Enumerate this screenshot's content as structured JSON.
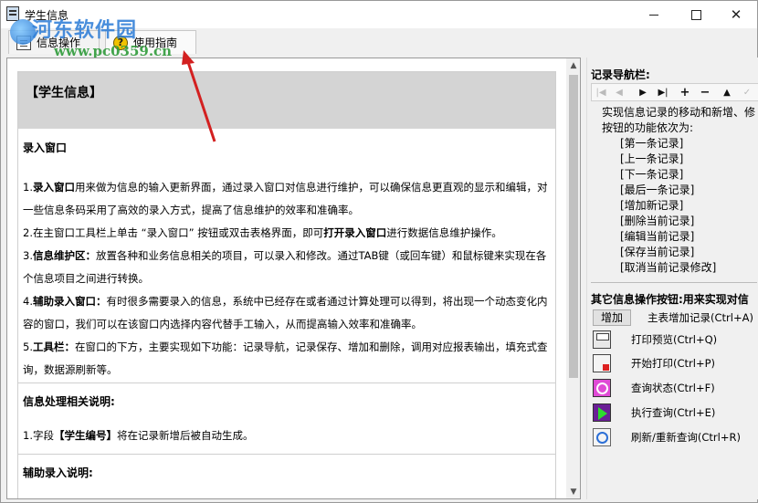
{
  "window": {
    "title": "学生信息",
    "watermark": "河东软件园",
    "watermark_url": "www.pc0359.cn"
  },
  "toolbar": {
    "info_ops_label": "信息操作",
    "guide_label": "使用指南"
  },
  "doc": {
    "header": "【学生信息】",
    "sections": [
      {
        "title": "录入窗口",
        "paras": [
          [
            "1.",
            "录入窗口",
            "用来做为信息的输入更新界面，通过录入窗口对信息进行维护，可以确保信息更直观的显示和编辑，对一些信息条码采用了高效的录入方式，提高了信息维护的效率和准确率。"
          ],
          [
            "2.在主窗口工具栏上单击 “录入窗口” 按钮或双击表格界面，即可",
            "打开录入窗口",
            "进行数据信息维护操作。"
          ],
          [
            "3.",
            "信息维护区：",
            "放置各种和业务信息相关的项目，可以录入和修改。通过TAB键（或回车键）和鼠标键来实现在各个信息项目之间进行转换。"
          ],
          [
            "4.",
            "辅助录入窗口：",
            "有时很多需要录入的信息，系统中已经存在或者通过计算处理可以得到，将出现一个动态变化内容的窗口，我们可以在该窗口内选择内容代替手工输入，从而提高输入效率和准确率。"
          ],
          [
            "5.",
            "工具栏：",
            "在窗口的下方，主要实现如下功能：记录导航，记录保存、增加和删除，调用对应报表输出，填充式查询，数据源刷新等。"
          ]
        ]
      },
      {
        "title": "信息处理相关说明:",
        "paras": [
          [
            "1.字段",
            "【学生编号】",
            "将在记录新增后被自动生成。"
          ]
        ]
      },
      {
        "title": "辅助录入说明:",
        "paras": []
      }
    ]
  },
  "side": {
    "nav_title": "记录导航栏:",
    "nav_desc_1": "实现信息记录的移动和新增、修",
    "nav_desc_2": "按钮的功能依次为:",
    "nav_items": [
      "[第一条记录]",
      "[上一条记录]",
      "[下一条记录]",
      "[最后一条记录]",
      "[增加新记录]",
      "[删除当前记录]",
      "[编辑当前记录]",
      "[保存当前记录]",
      "[取消当前记录修改]"
    ],
    "other_title": "其它信息操作按钮:用来实现对信",
    "add_button": "增加",
    "add_desc": "主表增加记录(Ctrl+A)",
    "ops": [
      {
        "icon": "print-preview-icon",
        "label": "打印预览(Ctrl+Q)"
      },
      {
        "icon": "start-print-icon",
        "label": "开始打印(Ctrl+P)"
      },
      {
        "icon": "query-status-icon",
        "label": "查询状态(Ctrl+F)"
      },
      {
        "icon": "execute-query-icon",
        "label": "执行查询(Ctrl+E)"
      },
      {
        "icon": "refresh-icon",
        "label": "刷新/重新查询(Ctrl+R)"
      }
    ]
  }
}
